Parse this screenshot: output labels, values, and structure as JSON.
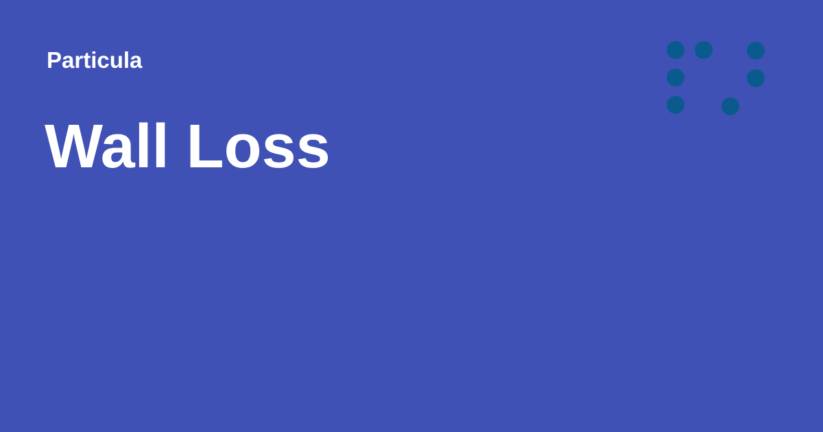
{
  "site": {
    "name": "Particula"
  },
  "page": {
    "title": "Wall Loss"
  },
  "colors": {
    "background": "#3f51b5",
    "text": "#ffffff",
    "logo_dots": "#0b5a8e"
  },
  "logo": {
    "icon": "dot-grid-logo-icon"
  }
}
